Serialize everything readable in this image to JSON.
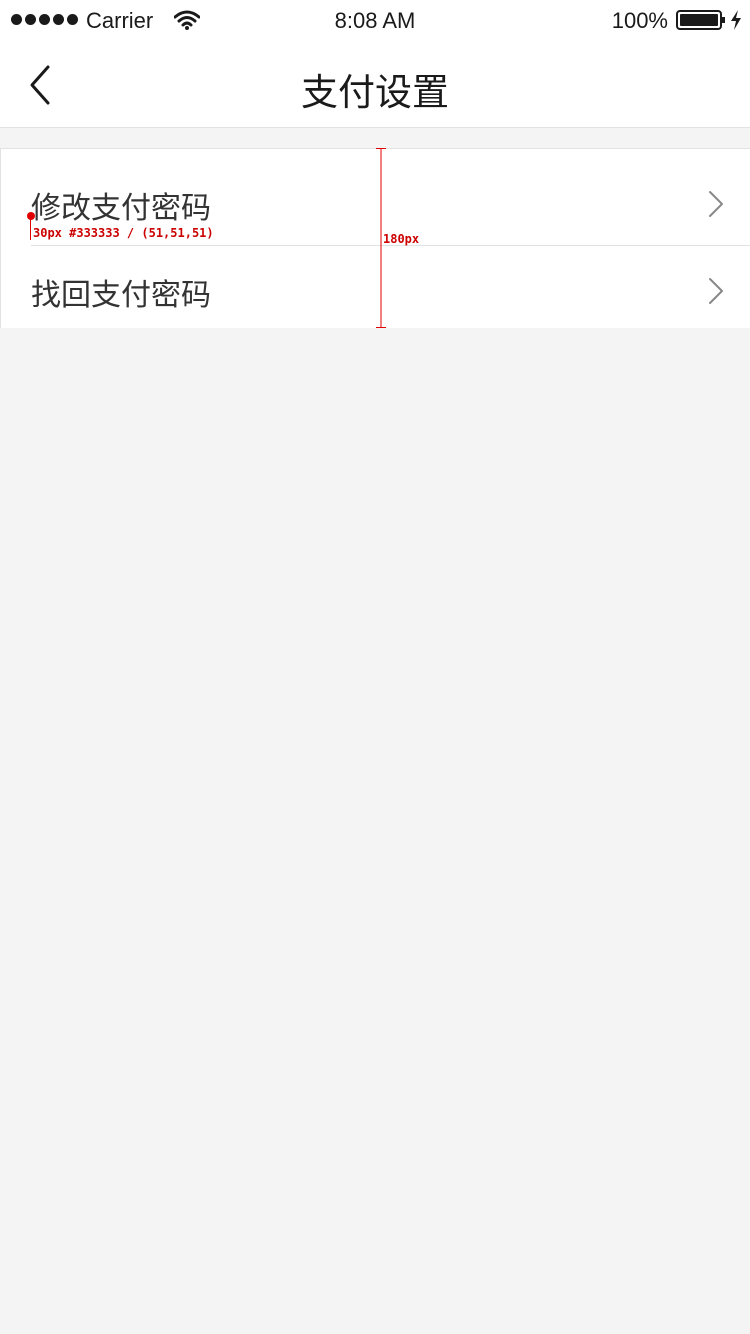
{
  "status_bar": {
    "carrier": "Carrier",
    "time": "8:08 AM",
    "battery": "100%",
    "icons": [
      "signal-dots",
      "wifi-icon",
      "battery-icon",
      "bolt-icon"
    ]
  },
  "nav": {
    "title": "支付设置",
    "back_icon": "chevron-left-icon"
  },
  "list": {
    "items": [
      {
        "label": "修改支付密码",
        "icon": "chevron-right-icon"
      },
      {
        "label": "找回支付密码",
        "icon": "chevron-right-icon"
      }
    ]
  },
  "annotations": {
    "font_spec": "30px #333333 / (51,51,51)",
    "height_spec": "180px"
  },
  "colors": {
    "text": "#333333",
    "background": "#f4f4f4",
    "annotation": "#cc0000"
  }
}
